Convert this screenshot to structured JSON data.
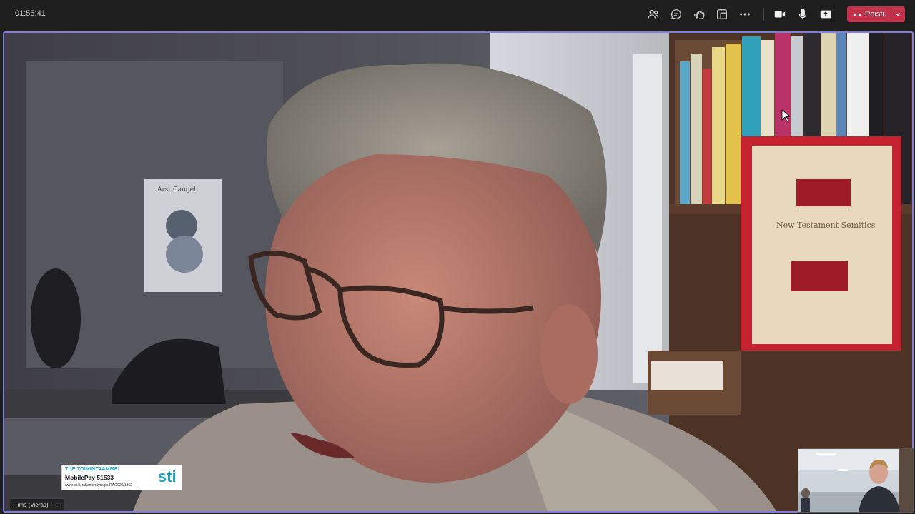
{
  "call": {
    "elapsed": "01:55:41"
  },
  "toolbar": {
    "buttons": [
      {
        "name": "participants",
        "icon": "people-icon"
      },
      {
        "name": "chat",
        "icon": "chat-icon"
      },
      {
        "name": "reactions",
        "icon": "reactions-icon"
      },
      {
        "name": "rooms",
        "icon": "rooms-icon"
      },
      {
        "name": "more",
        "icon": "more-icon"
      },
      {
        "name": "camera",
        "icon": "camera-icon"
      },
      {
        "name": "mic",
        "icon": "mic-icon"
      },
      {
        "name": "share",
        "icon": "share-icon"
      }
    ],
    "leave_label": "Poistu",
    "leave_color": "#c4314b"
  },
  "stage": {
    "speaker_name": "Timo (Vieras)",
    "more_label": "···",
    "active_border_color": "#7f7fd6",
    "book_title": "New Testament Semitics",
    "poster_text": "Arst Caugel"
  },
  "promo": {
    "line1": "TUE TOIMINTAAMME!",
    "line2": "MobilePay 51533",
    "line3": "www.sti.fi, rahankeräyslupa RA/2020/1362",
    "logo": "sti",
    "accent": "#1ba6c9"
  }
}
